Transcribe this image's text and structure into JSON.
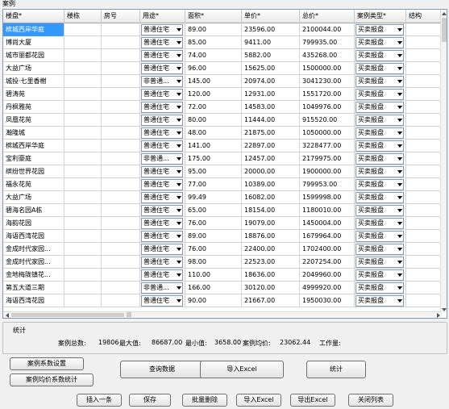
{
  "panel_title": "案例",
  "columns": [
    "楼盘*",
    "楼栋",
    "房号",
    "用途*",
    "面积*",
    "单价*",
    "总价*",
    "案例类型*",
    "结构"
  ],
  "rows": [
    {
      "name": "槟城西岸华庭",
      "usage": "普通住宅",
      "area": "89.00",
      "price": "23596.00",
      "total": "2100044.00",
      "type": "买卖报盘",
      "selected": true
    },
    {
      "name": "博尚大厦",
      "usage": "普通住宅",
      "area": "85.00",
      "price": "9411.00",
      "total": "799935.00",
      "type": "买卖报盘"
    },
    {
      "name": "城市丽都花园",
      "usage": "普通住宅",
      "area": "74.00",
      "price": "5882.00",
      "total": "435268.00",
      "type": "买卖报盘"
    },
    {
      "name": "大益广场",
      "usage": "普通住宅",
      "area": "96.00",
      "price": "15625.00",
      "total": "1500000.00",
      "type": "买卖报盘"
    },
    {
      "name": "城投·七里香榭",
      "usage": "非普通...",
      "area": "145.00",
      "price": "20974.00",
      "total": "3041230.00",
      "type": "买卖报盘"
    },
    {
      "name": "碧涛苑",
      "usage": "普通住宅",
      "area": "120.00",
      "price": "12931.00",
      "total": "1551720.00",
      "type": "买卖报盘"
    },
    {
      "name": "丹枫雅苑",
      "usage": "普通住宅",
      "area": "72.00",
      "price": "14583.00",
      "total": "1049976.00",
      "type": "买卖报盘"
    },
    {
      "name": "凤凰花苑",
      "usage": "普通住宅",
      "area": "80.00",
      "price": "11444.00",
      "total": "915520.00",
      "type": "买卖报盘"
    },
    {
      "name": "瀚隆城",
      "usage": "普通住宅",
      "area": "48.00",
      "price": "21875.00",
      "total": "1050000.00",
      "type": "买卖报盘"
    },
    {
      "name": "槟城西岸华庭",
      "usage": "普通住宅",
      "area": "141.00",
      "price": "22897.00",
      "total": "3228477.00",
      "type": "买卖报盘"
    },
    {
      "name": "宝利豪庭",
      "usage": "非普通...",
      "area": "175.00",
      "price": "12457.00",
      "total": "2179975.00",
      "type": "买卖报盘"
    },
    {
      "name": "缤纷世界花园",
      "usage": "普通住宅",
      "area": "95.00",
      "price": "20000.00",
      "total": "1900000.00",
      "type": "买卖报盘"
    },
    {
      "name": "福永花苑",
      "usage": "普通住宅",
      "area": "77.00",
      "price": "10389.00",
      "total": "799953.00",
      "type": "买卖报盘"
    },
    {
      "name": "大益广场",
      "usage": "普通住宅",
      "area": "99.49",
      "price": "16082.00",
      "total": "1599998.00",
      "type": "买卖报盘"
    },
    {
      "name": "碧海名园A栋",
      "usage": "普通住宅",
      "area": "65.00",
      "price": "18154.00",
      "total": "1180010.00",
      "type": "买卖报盘"
    },
    {
      "name": "海韵花园",
      "usage": "普通住宅",
      "area": "76.00",
      "price": "19079.00",
      "total": "1450004.00",
      "type": "买卖报盘"
    },
    {
      "name": "海语西湾花园",
      "usage": "普通住宅",
      "area": "89.00",
      "price": "18876.00",
      "total": "1679964.00",
      "type": "买卖报盘"
    },
    {
      "name": "金成时代家园...",
      "usage": "普通住宅",
      "area": "76.00",
      "price": "22400.00",
      "total": "1702400.00",
      "type": "买卖报盘"
    },
    {
      "name": "金成时代家园...",
      "usage": "普通住宅",
      "area": "98.00",
      "price": "22523.00",
      "total": "2207254.00",
      "type": "买卖报盘"
    },
    {
      "name": "金地梅陇镇花...",
      "usage": "普通住宅",
      "area": "110.00",
      "price": "18636.00",
      "total": "2049960.00",
      "type": "买卖报盘"
    },
    {
      "name": "第五大道三期",
      "usage": "非普通...",
      "area": "166.00",
      "price": "30120.00",
      "total": "4999920.00",
      "type": "买卖报盘"
    },
    {
      "name": "海语西湾花园",
      "usage": "普通住宅",
      "area": "90.00",
      "price": "21667.00",
      "total": "1950030.00",
      "type": "买卖报盘"
    }
  ],
  "stats": {
    "title": "统计",
    "count_label": "案例总数:",
    "count": "19806",
    "max_label": "最大值:",
    "max": "86687.00",
    "min_label": "最小值:",
    "min": "3658.00",
    "avg_label": "案例均价:",
    "avg": "23062.44",
    "workload_label": "工作量:"
  },
  "buttons": {
    "case_coeff": "案例系数设置",
    "avg_coeff": "案例均价系数统计",
    "query": "查询数据",
    "import_excel_top": "导入Excel",
    "stats": "统计",
    "insert": "插入一条",
    "save": "保存",
    "batch_delete": "批量删除",
    "import_excel": "导入Excel",
    "export_excel": "导出Excel",
    "close_list": "关闭列表"
  },
  "colors": {
    "selection": "#3399ff",
    "border": "#7f9db9"
  }
}
